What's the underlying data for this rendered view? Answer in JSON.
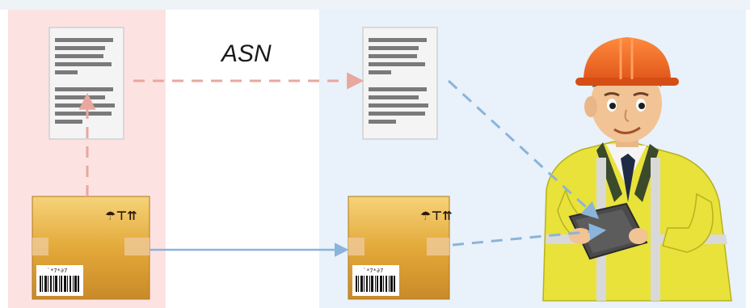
{
  "diagram": {
    "flow_label": "ASN",
    "colors": {
      "sender_zone": "#fde2e2",
      "receiver_zone": "#e9f1fa",
      "top_strip": "#eef3f8",
      "document_flow": "#e8a89f",
      "goods_flow": "#8ab4db",
      "scan_flow": "#8ab4db"
    },
    "sender": {
      "document_icon": "document-icon",
      "package_icon": "cardboard-box-icon",
      "package_marks": "☂⊤⇈",
      "barcode_caption": "`*7*∂7"
    },
    "receiver": {
      "document_icon": "document-icon",
      "package_icon": "cardboard-box-icon",
      "package_marks": "☂⊤⇈",
      "barcode_caption": "`*7*∂7"
    },
    "worker": {
      "figure": "warehouse-worker-with-hardhat",
      "device": "tablet-scanner-icon"
    }
  }
}
